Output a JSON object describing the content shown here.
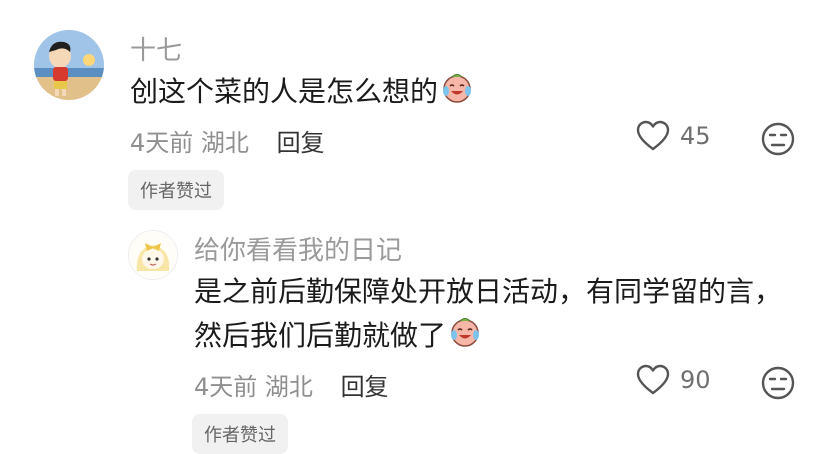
{
  "comments": [
    {
      "username": "十七",
      "text": "创这个菜的人是怎么想的",
      "time": "4天前",
      "location": "湖北",
      "reply_label": "回复",
      "likes": "45",
      "badge": "作者赞过",
      "emoji_icon": "crying-laughing-face-icon",
      "avatar_icon": "cartoon-boy-at-beach-avatar"
    },
    {
      "username": "给你看看我的日记",
      "text_line1": "是之前后勤保障处开放日活动，有同学留的言，",
      "text_line2": "然后我们后勤就做了",
      "time": "4天前",
      "location": "湖北",
      "reply_label": "回复",
      "likes": "90",
      "badge": "作者赞过",
      "emoji_icon": "crying-laughing-face-icon",
      "avatar_icon": "cartoon-girl-with-bow-avatar"
    }
  ]
}
